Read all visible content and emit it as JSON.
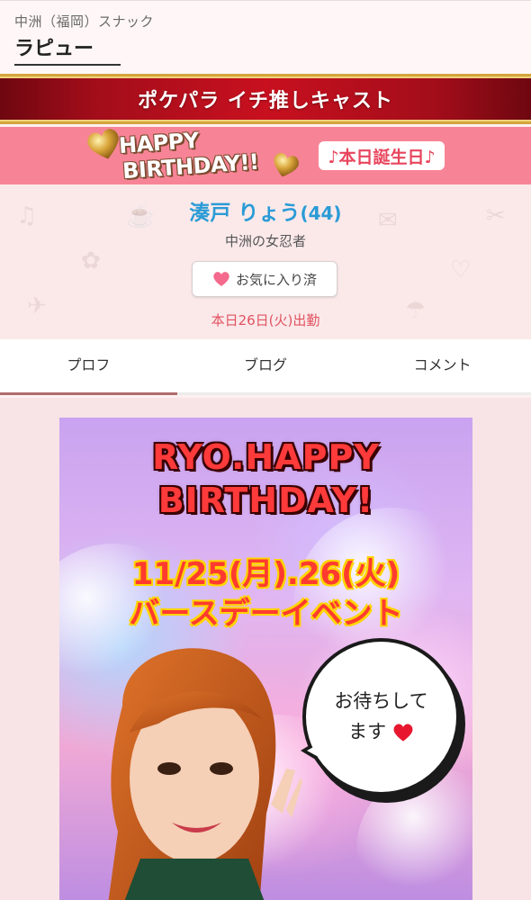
{
  "header": {
    "area_category": "中洲（福岡）スナック",
    "shop_name": "ラピュー"
  },
  "banner": {
    "title": "ポケパラ イチ推しキャスト",
    "colors": {
      "base": "#c8101f",
      "trim": "#d4a43c"
    }
  },
  "birthday": {
    "art_line1": "HAPPY",
    "art_line2": "BIRTHDAY!!",
    "badge": "♪本日誕生日♪",
    "strip_color": "#f78496"
  },
  "profile": {
    "name": "湊戸 りょう",
    "age": "(44)",
    "catchphrase": "中洲の女忍者",
    "favorite_label": "お気に入り済",
    "workday": "本日26日(火)出勤",
    "name_color": "#2a9bd6"
  },
  "tabs": [
    {
      "label": "プロフ",
      "active": true
    },
    {
      "label": "ブログ",
      "active": false
    },
    {
      "label": "コメント",
      "active": false
    }
  ],
  "poster": {
    "title_line1": "RYO.HAPPY",
    "title_line2": "BIRTHDAY!",
    "date_line1": "11/25(月).26(火)",
    "date_line2": "バースデーイベント",
    "bubble_line1": "お待ちして",
    "bubble_line2": "ます",
    "icons": [
      "heart-icon",
      "gold-heart-icon"
    ]
  }
}
